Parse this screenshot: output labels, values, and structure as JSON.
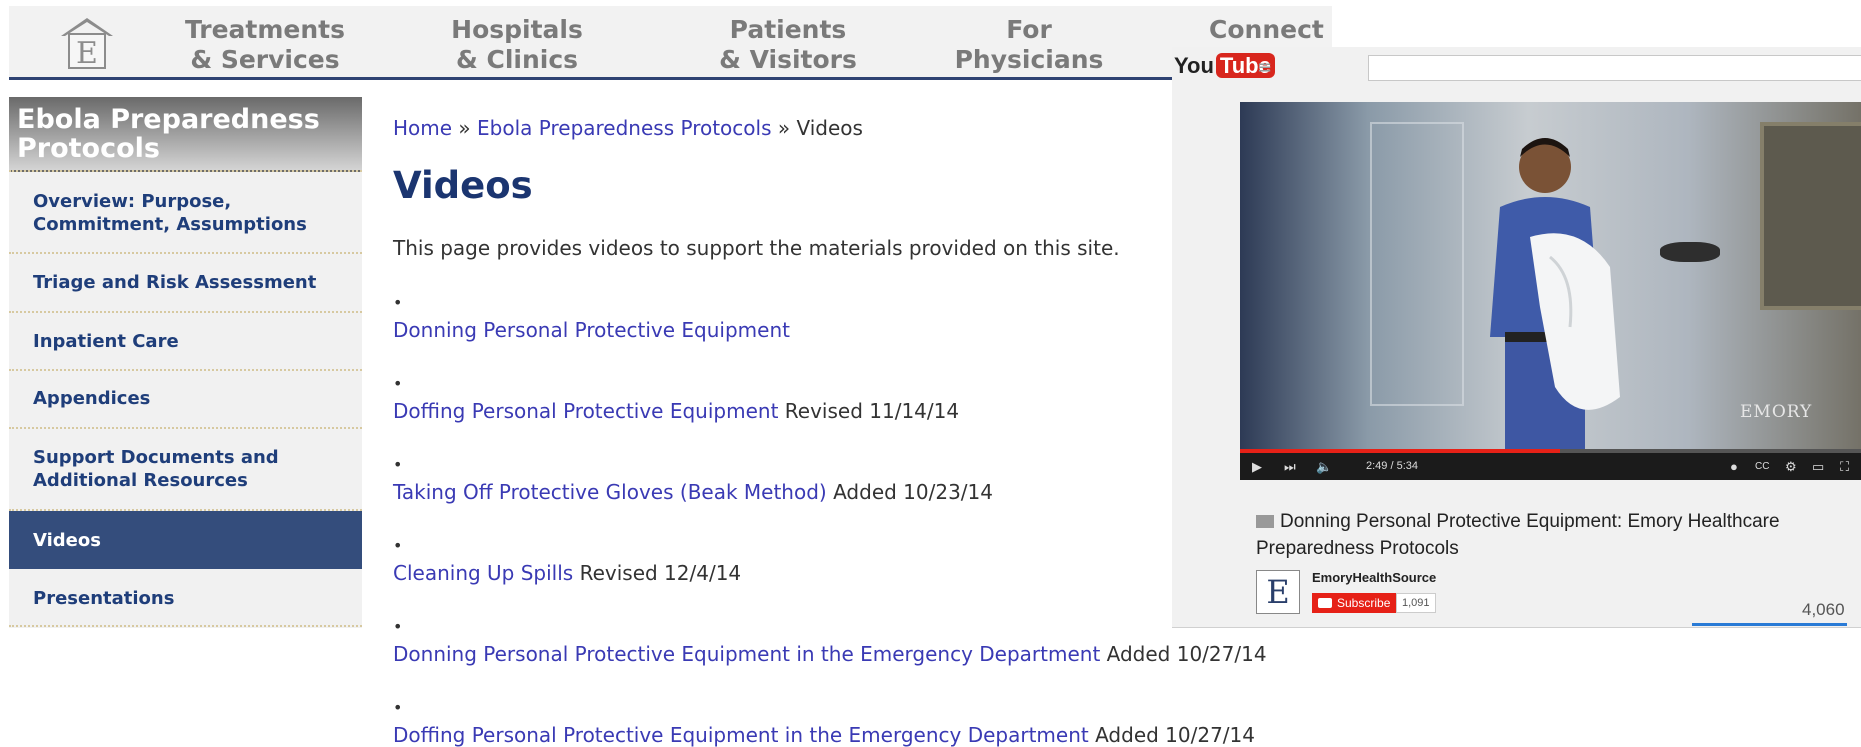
{
  "nav": {
    "items": [
      {
        "line1": "Treatments",
        "line2": "& Services"
      },
      {
        "line1": "Hospitals",
        "line2": "& Clinics"
      },
      {
        "line1": "Patients",
        "line2": "& Visitors"
      },
      {
        "line1": "For",
        "line2": "Physicians"
      },
      {
        "line1": "Connect",
        "line2": ""
      }
    ]
  },
  "sidebar": {
    "heading": "Ebola Preparedness Protocols",
    "items": [
      {
        "label": "Overview: Purpose, Commitment, Assumptions",
        "active": false
      },
      {
        "label": "Triage and Risk Assessment",
        "active": false
      },
      {
        "label": "Inpatient Care",
        "active": false
      },
      {
        "label": "Appendices",
        "active": false
      },
      {
        "label": "Support Documents and Additional Resources",
        "active": false
      },
      {
        "label": "Videos",
        "active": true
      },
      {
        "label": "Presentations",
        "active": false
      }
    ]
  },
  "breadcrumb": {
    "home": "Home",
    "sep": "»",
    "section": "Ebola Preparedness Protocols",
    "current": "Videos"
  },
  "main": {
    "title": "Videos",
    "intro": "This page provides videos to support the materials provided on this site.",
    "bullet": "•",
    "videos": [
      {
        "link": "Donning Personal Protective Equipment",
        "note": ""
      },
      {
        "link": "Doffing Personal Protective Equipment",
        "note": "Revised 11/14/14"
      },
      {
        "link": "Taking Off Protective Gloves (Beak Method)",
        "note": "Added 10/23/14"
      },
      {
        "link": "Cleaning Up Spills",
        "note": "Revised 12/4/14"
      },
      {
        "link": "Donning Personal Protective Equipment in the Emergency Department",
        "note": "Added 10/27/14"
      },
      {
        "link": "Doffing Personal Protective Equipment in the Emergency Department",
        "note": "Added 10/27/14"
      }
    ]
  },
  "youtube": {
    "logo_you": "You",
    "logo_tube": "Tube",
    "menu_icon": "≡",
    "player": {
      "time_current": "2:49",
      "time_total": "5:34",
      "progress_fraction": 0.5,
      "watermark": "EMORY"
    },
    "video_title": "Donning Personal Protective Equipment: Emory Healthcare Preparedness Protocols",
    "channel_initial": "E",
    "channel_name": "EmoryHealthSource",
    "subscribe_label": "Subscribe",
    "subscriber_count": "1,091",
    "view_count": "4,060"
  }
}
